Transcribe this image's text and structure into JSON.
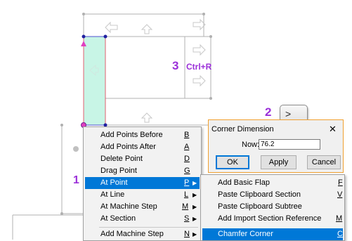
{
  "steps": {
    "step1": "1",
    "step2": "2",
    "step3": "3",
    "step3_hint": "Ctrl+R"
  },
  "keycap": {
    "top": ">",
    "bottom": "▪"
  },
  "context_menu": {
    "items": [
      {
        "label": "Add Points Before",
        "shortcut": "B"
      },
      {
        "label": "Add Points After",
        "shortcut": "A"
      },
      {
        "label": "Delete Point",
        "shortcut": "D"
      },
      {
        "label": "Drag Point",
        "shortcut": "G"
      },
      {
        "label": "At Point",
        "shortcut": "P"
      },
      {
        "label": "At Line",
        "shortcut": "L"
      },
      {
        "label": "At Machine Step",
        "shortcut": "M"
      },
      {
        "label": "At Section",
        "shortcut": "S"
      },
      {
        "label": "Add Machine Step",
        "shortcut": "N"
      }
    ]
  },
  "submenu": {
    "items": [
      {
        "label": "Add Basic Flap",
        "shortcut": "F"
      },
      {
        "label": "Paste Clipboard Section",
        "shortcut": "V"
      },
      {
        "label": "Paste Clipboard Subtree",
        "shortcut": ""
      },
      {
        "label": "Add Import Section Reference",
        "shortcut": "M"
      },
      {
        "label": "Chamfer Corner",
        "shortcut": "C"
      }
    ]
  },
  "dialog": {
    "title": "Corner Dimension",
    "close": "✕",
    "now_label": "Now:",
    "now_value": "76.2",
    "ok": "OK",
    "apply": "Apply",
    "cancel": "Cancel"
  },
  "colors": {
    "accent_purple": "#9b30d9",
    "highlight": "#0078d7",
    "shape_fill": "#c8f5e6",
    "dialog_border": "#f0a030"
  }
}
